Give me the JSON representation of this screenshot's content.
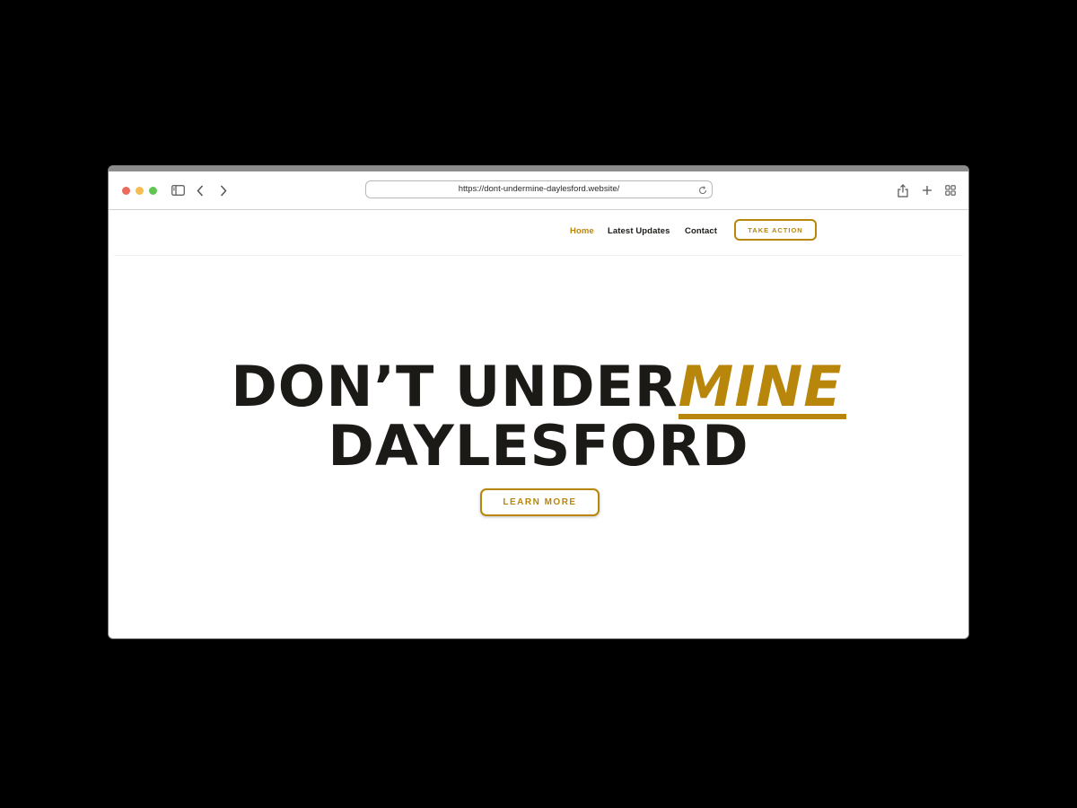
{
  "browser": {
    "url": "https://dont-undermine-daylesford.website/",
    "traffic_lights": {
      "close_color": "#ec6a5e",
      "minimize_color": "#f4bf4f",
      "zoom_color": "#61c554"
    },
    "icons": [
      "sidebar-icon",
      "chevron-left-icon",
      "chevron-right-icon",
      "reload-icon",
      "share-icon",
      "plus-icon",
      "tab-overview-icon"
    ]
  },
  "nav": {
    "items": [
      {
        "label": "Home",
        "active": true
      },
      {
        "label": "Latest Updates",
        "active": false
      },
      {
        "label": "Contact",
        "active": false
      }
    ],
    "cta_label": "TAKE ACTION"
  },
  "hero": {
    "line1_prefix": "DON’T UNDER",
    "line1_accent": "MINE",
    "line2": "DAYLESFORD",
    "button_label": "LEARN MORE"
  },
  "colors": {
    "accent": "#b8860b",
    "text_dark": "#1c1a16",
    "page_bg": "#ffffff",
    "backdrop": "#000000"
  }
}
